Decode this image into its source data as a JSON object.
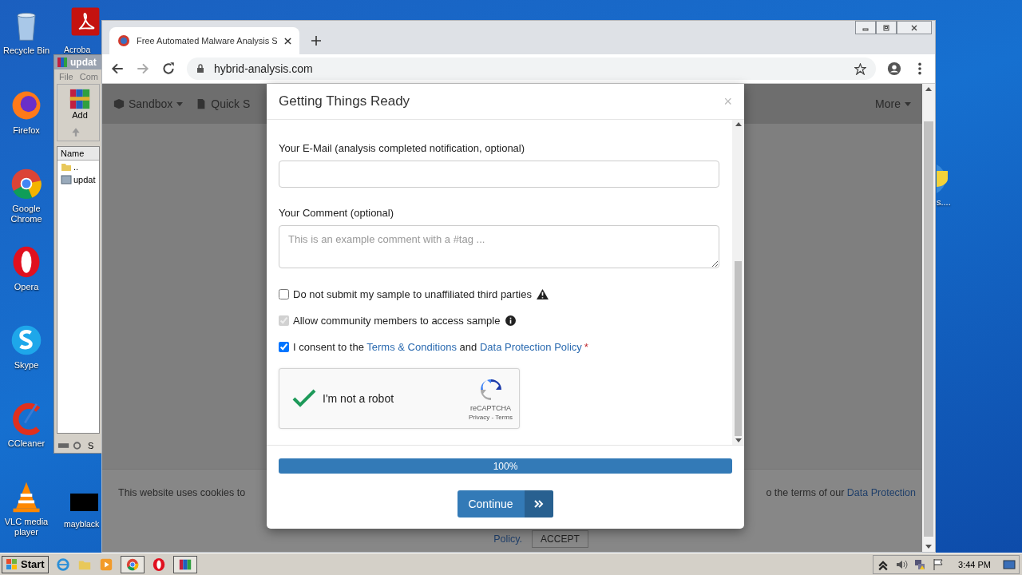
{
  "desktop_icons": [
    {
      "label": "Recycle Bin"
    },
    {
      "label": "Firefox"
    },
    {
      "label": "Google Chrome"
    },
    {
      "label": "Opera"
    },
    {
      "label": "Skype"
    },
    {
      "label": "CCleaner"
    },
    {
      "label": "VLC media player"
    }
  ],
  "desktop_icons_2": [
    {
      "label": "Acroba"
    },
    {
      "label": "mayblack"
    },
    {
      "label": "s...."
    }
  ],
  "winrar": {
    "title": "updat",
    "menu": [
      "File",
      "Com"
    ],
    "toolbar_button": "Add",
    "column": "Name",
    "rows": [
      "..",
      "updat"
    ],
    "status": "S"
  },
  "browser": {
    "tab_title": "Free Automated Malware Analysis S",
    "url": "hybrid-analysis.com"
  },
  "page": {
    "nav": [
      {
        "label": "Sandbox"
      },
      {
        "label": "Quick S"
      },
      {
        "label": "More"
      }
    ],
    "cookie_notice": {
      "text_left": "This website uses cookies to",
      "text_right": "o the terms of our",
      "link": "Data Protection",
      "link_2": "Policy.",
      "button": "ACCEPT"
    }
  },
  "modal": {
    "title": "Getting Things Ready",
    "close": "×",
    "email": {
      "label": "Your E-Mail (analysis completed notification, optional)"
    },
    "comment": {
      "label": "Your Comment (optional)",
      "placeholder": "This is an example comment with a #tag ..."
    },
    "options": [
      {
        "label": "Do not submit my sample to unaffiliated third parties",
        "checked": false,
        "disabled": false
      },
      {
        "label": "Allow community members to access sample",
        "checked": true,
        "disabled": true
      }
    ],
    "consent": {
      "checked": true,
      "prefix": "I consent to the",
      "link": "Terms & Conditions",
      "middle": "and",
      "link_2": "Data Protection Policy",
      "required": "*"
    },
    "captcha": {
      "label": "I'm not a robot",
      "checked": true,
      "brand": "reCAPTCHA",
      "links": "Privacy - Terms"
    },
    "progress": {
      "level": 1,
      "reading": "100%"
    },
    "button": "Continue"
  },
  "taskbar": {
    "start": "Start",
    "clock": "3:44 PM"
  }
}
